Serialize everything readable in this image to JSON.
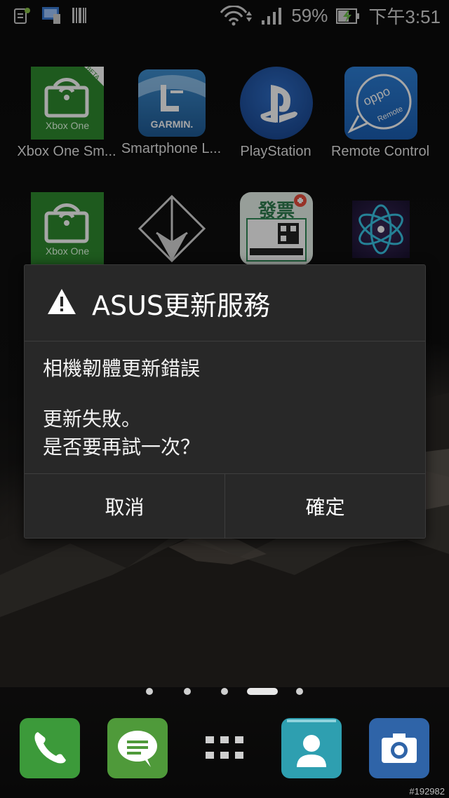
{
  "status_bar": {
    "battery_percent": "59%",
    "time": "下午3:51",
    "icons": [
      "sim-card-icon",
      "screen-cast-icon",
      "barcode-icon",
      "wifi-icon",
      "signal-icon",
      "battery-charging-icon"
    ]
  },
  "apps": [
    {
      "label": "Xbox One Sm...",
      "icon": "xbox-smartglass-icon",
      "icon_text": "Xbox One",
      "badge": "BETA"
    },
    {
      "label": "Smartphone L...",
      "icon": "garmin-icon",
      "icon_text": "GARMIN."
    },
    {
      "label": "PlayStation",
      "icon": "playstation-icon"
    },
    {
      "label": "Remote Control",
      "icon": "oppo-remote-icon",
      "icon_text": "oppo",
      "icon_subtext": "Remote"
    },
    {
      "label": "",
      "icon": "xbox-one-icon",
      "icon_text": "Xbox One"
    },
    {
      "label": "",
      "icon": "diamond-app-icon"
    },
    {
      "label": "",
      "icon": "invoice-app-icon",
      "icon_text": "發票"
    },
    {
      "label": "",
      "icon": "network-app-icon"
    }
  ],
  "dialog": {
    "title": "ASUS更新服務",
    "title_icon": "warning-icon",
    "message_line1": "相機韌體更新錯誤",
    "message_line2": "更新失敗。",
    "message_line3": "是否要再試一次？",
    "cancel_label": "取消",
    "ok_label": "確定"
  },
  "page_indicator": {
    "pages": 5,
    "current": 4
  },
  "dock": [
    {
      "icon": "phone-icon",
      "color": "#3c9a3a"
    },
    {
      "icon": "messaging-icon",
      "color": "#4f9a3a"
    },
    {
      "icon": "app-drawer-icon",
      "color": "#cfcfcf"
    },
    {
      "icon": "contacts-icon",
      "color": "#2e9fb0"
    },
    {
      "icon": "camera-icon",
      "color": "#2f64a8"
    }
  ],
  "watermark": "#192982",
  "colors": {
    "dialog_bg": "#282828",
    "xbox_green": "#2e8b2e",
    "garmin_blue": "#1f5b96",
    "playstation_blue": "#1f57a8"
  }
}
